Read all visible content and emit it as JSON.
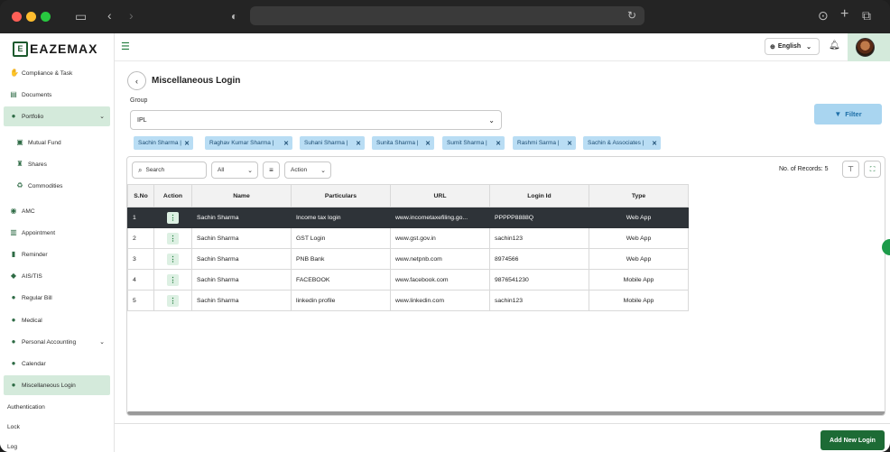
{
  "app": {
    "logo_mark": "E",
    "logo_text": "EAZEMAX"
  },
  "colors": {
    "brand_green": "#1d6b35",
    "active_bg": "#d4eadb",
    "chip_bg": "#b9ddf4",
    "filter_bg": "#a9d5f0",
    "selected_row_bg": "#2e3338"
  },
  "sidebar": {
    "items": [
      {
        "label": "Compliance & Task",
        "icon": "handshake-icon"
      },
      {
        "label": "Documents",
        "icon": "document-icon"
      },
      {
        "label": "Portfolio",
        "icon": "user-icon"
      },
      {
        "label": "Mutual Fund",
        "icon": "briefcase-icon"
      },
      {
        "label": "Shares",
        "icon": "trophy-icon"
      },
      {
        "label": "Commodities",
        "icon": "recycle-icon"
      },
      {
        "label": "AMC",
        "icon": "globe-icon"
      },
      {
        "label": "Appointment",
        "icon": "calendar-icon"
      },
      {
        "label": "Reminder",
        "icon": "bell-icon"
      },
      {
        "label": "AIS/TIS",
        "icon": "tag-icon"
      },
      {
        "label": "Regular Bill",
        "icon": "users-icon"
      },
      {
        "label": "Medical",
        "icon": "users-icon"
      },
      {
        "label": "Personal Accounting",
        "icon": "users-icon"
      },
      {
        "label": "Calendar",
        "icon": "users-icon"
      },
      {
        "label": "Miscellaneous Login",
        "icon": "users-icon"
      },
      {
        "label": "Authentication"
      },
      {
        "label": "Lock"
      },
      {
        "label": "Log"
      }
    ]
  },
  "topbar": {
    "language": "English"
  },
  "page": {
    "title": "Miscellaneous Login"
  },
  "group": {
    "label": "Group",
    "value": "IPL"
  },
  "filter_label": "Filter",
  "chips": [
    "Sachin Sharma",
    "Raghav Kumar Sharma",
    "Suhani Sharma",
    "Sunita Sharma",
    "Sumit Sharma",
    "Rashmi Sarma",
    "Sachin & Associates"
  ],
  "toolbar": {
    "search_placeholder": "Search",
    "status_value": "All",
    "action_label": "Action",
    "records_text": "No. of Records: 5"
  },
  "table": {
    "headers": [
      "S.No",
      "Action",
      "Name",
      "Particulars",
      "URL",
      "Login Id",
      "Type"
    ],
    "rows": [
      {
        "sno": "1",
        "name": "Sachin Sharma",
        "particulars": "Income tax login",
        "url": "www.incometaxefiling.go...",
        "login_id": "PPPPP8888Q",
        "type": "Web App"
      },
      {
        "sno": "2",
        "name": "Sachin Sharma",
        "particulars": "GST Login",
        "url": "www.gst.gov.in",
        "login_id": "sachin123",
        "type": "Web App"
      },
      {
        "sno": "3",
        "name": "Sachin Sharma",
        "particulars": "PNB Bank",
        "url": "www.netpnb.com",
        "login_id": "8974566",
        "type": "Web App"
      },
      {
        "sno": "4",
        "name": "Sachin Sharma",
        "particulars": "FACEBOOK",
        "url": "www.facebook.com",
        "login_id": "9876541230",
        "type": "Mobile App"
      },
      {
        "sno": "5",
        "name": "Sachin Sharma",
        "particulars": "linkedin profile",
        "url": "www.linkedin.com",
        "login_id": "sachin123",
        "type": "Mobile App"
      }
    ]
  },
  "add_button": "Add New Login"
}
